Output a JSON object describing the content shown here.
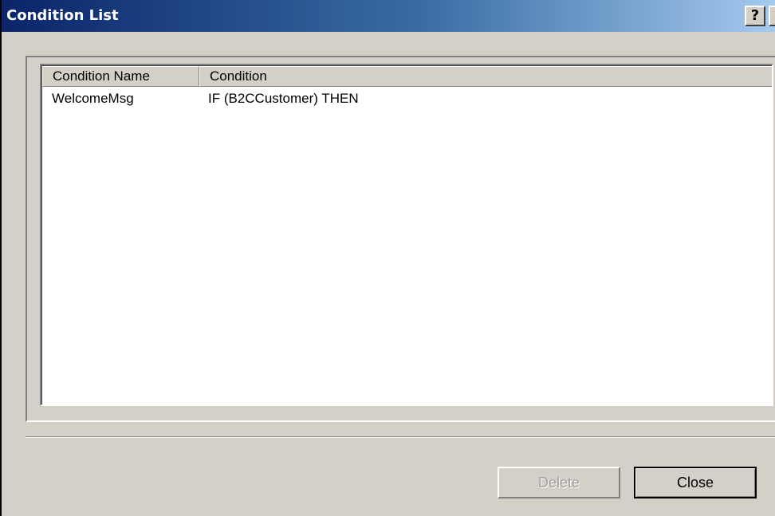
{
  "window": {
    "title": "Condition List",
    "help_glyph": "?",
    "close_glyph": "✕"
  },
  "list": {
    "columns": [
      "Condition Name",
      "Condition"
    ],
    "rows": [
      {
        "name": "WelcomeMsg",
        "condition": "IF (B2CCustomer) THEN"
      }
    ]
  },
  "buttons": {
    "delete_label": "Delete",
    "delete_enabled": false,
    "close_label": "Close"
  },
  "colors": {
    "titlebar_start": "#0a246a",
    "titlebar_end": "#a6caf0",
    "face": "#d4d0c8",
    "disabled_text": "#a0a0a0"
  }
}
